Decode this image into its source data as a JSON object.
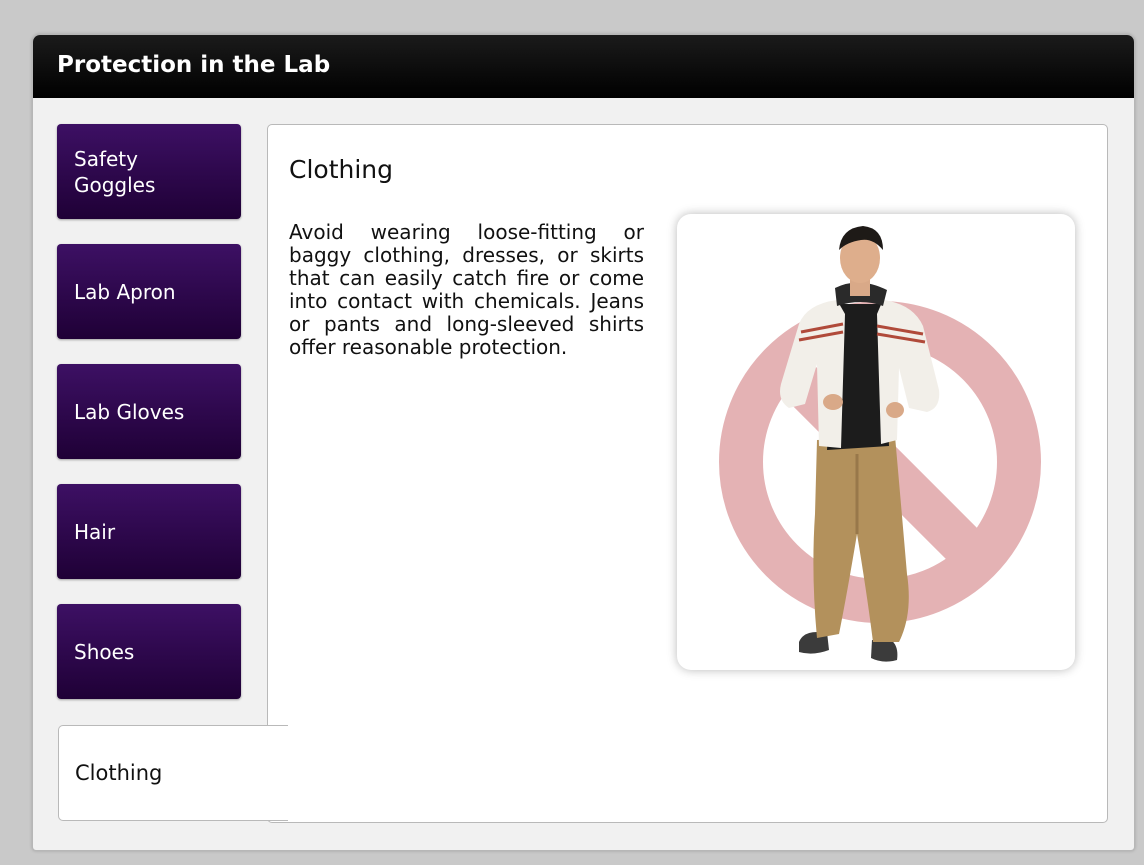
{
  "window": {
    "title": "Protection in the Lab"
  },
  "sidebar": {
    "items": [
      {
        "label": "Safety Goggles",
        "line1": "Safety",
        "line2": "Goggles"
      },
      {
        "label": "Lab Apron"
      },
      {
        "label": "Lab Gloves"
      },
      {
        "label": "Hair"
      },
      {
        "label": "Shoes"
      },
      {
        "label": "Clothing",
        "active": true
      }
    ]
  },
  "content": {
    "title": "Clothing",
    "body": "Avoid wearing loose-fitting or baggy clothing, dresses, or skirts that can easily catch fire or come into contact with chemicals. Jeans or pants and long-sleeved shirts offer reasonable protection.",
    "image": {
      "subject": "person-in-casual-clothing",
      "overlay": "prohibited-sign-icon"
    }
  },
  "colors": {
    "tab_purple": "#2c084a",
    "titlebar": "#000000",
    "prohibit_pink": "#e4b2b4"
  }
}
